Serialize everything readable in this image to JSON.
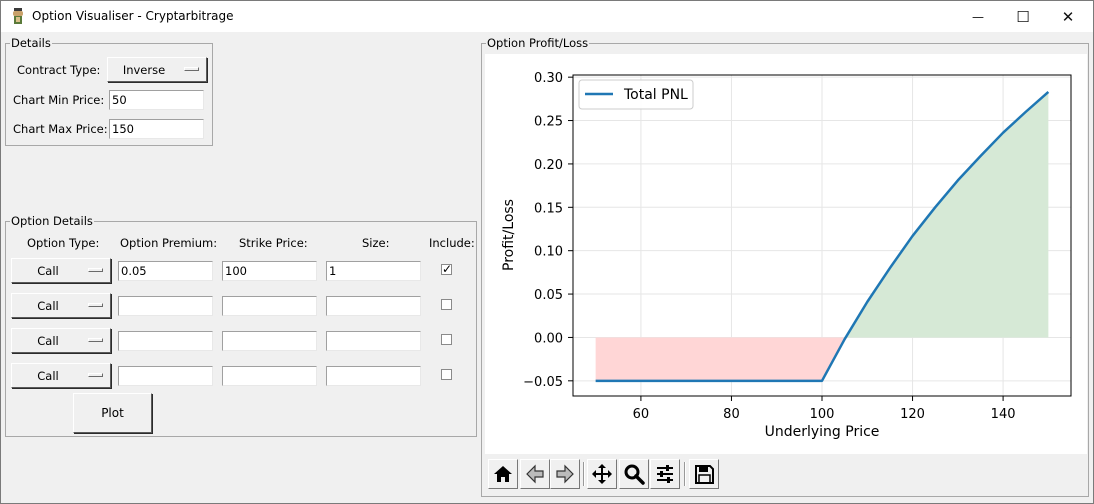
{
  "window": {
    "title": "Option Visualiser - Cryptarbitrage",
    "controls": {
      "minimize": "—",
      "maximize": "☐",
      "close": "✕"
    }
  },
  "details": {
    "legend": "Details",
    "contract_type_label": "Contract Type:",
    "contract_type_value": "Inverse",
    "min_price_label": "Chart Min Price:",
    "min_price_value": "50",
    "max_price_label": "Chart Max Price:",
    "max_price_value": "150"
  },
  "option_details": {
    "legend": "Option Details",
    "headers": {
      "type": "Option Type:",
      "premium": "Option Premium:",
      "strike": "Strike Price:",
      "size": "Size:",
      "include": "Include:"
    },
    "rows": [
      {
        "type": "Call",
        "premium": "0.05",
        "strike": "100",
        "size": "1",
        "include": true
      },
      {
        "type": "Call",
        "premium": "",
        "strike": "",
        "size": "",
        "include": false
      },
      {
        "type": "Call",
        "premium": "",
        "strike": "",
        "size": "",
        "include": false
      },
      {
        "type": "Call",
        "premium": "",
        "strike": "",
        "size": "",
        "include": false
      }
    ],
    "plot_label": "Plot"
  },
  "pnl_panel": {
    "legend": "Option Profit/Loss",
    "toolbar_icons": [
      "home-icon",
      "back-arrow-icon",
      "forward-arrow-icon",
      "pan-icon",
      "zoom-icon",
      "configure-subplots-icon",
      "save-icon"
    ]
  },
  "chart_data": {
    "type": "line",
    "title": "",
    "xlabel": "Underlying Price",
    "ylabel": "Profit/Loss",
    "xlim": [
      45,
      155
    ],
    "ylim": [
      -0.0675,
      0.3025
    ],
    "xticks": [
      60,
      80,
      100,
      120,
      140
    ],
    "yticks": [
      -0.05,
      0.0,
      0.05,
      0.1,
      0.15,
      0.2,
      0.25,
      0.3
    ],
    "ytick_labels": [
      "−0.05",
      "0.00",
      "0.05",
      "0.10",
      "0.15",
      "0.20",
      "0.25",
      "0.30"
    ],
    "grid": true,
    "legend_position": "top-left",
    "series": [
      {
        "name": "Total PNL",
        "color": "#1f77b4",
        "x": [
          50,
          60,
          70,
          80,
          90,
          100,
          105,
          110,
          115,
          120,
          125,
          130,
          135,
          140,
          145,
          150
        ],
        "y": [
          -0.05,
          -0.05,
          -0.05,
          -0.05,
          -0.05,
          -0.05,
          -0.002,
          0.041,
          0.08,
          0.117,
          0.15,
          0.181,
          0.209,
          0.236,
          0.26,
          0.283
        ]
      }
    ],
    "fill_positive_color": "#d6e9d6",
    "fill_negative_color": "#ffd6d6"
  }
}
